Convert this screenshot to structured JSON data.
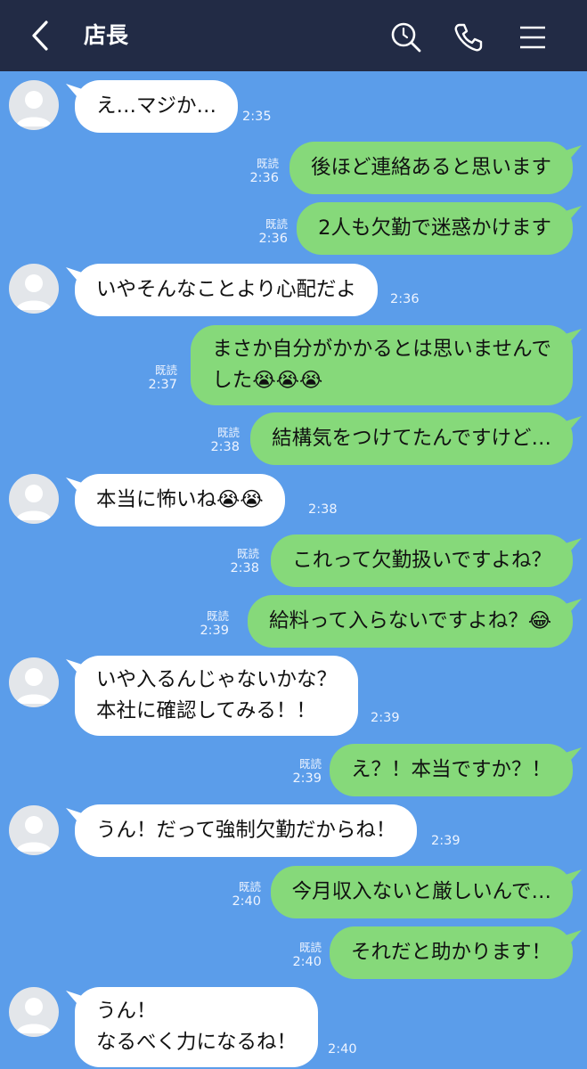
{
  "header": {
    "title": "店長",
    "bg_color": "#222b45"
  },
  "colors": {
    "background": "#5b9dea",
    "incoming_bubble": "#ffffff",
    "outgoing_bubble": "#86d97a"
  },
  "messages": [
    {
      "dir": "in",
      "text": "え…マジか…",
      "time": "2:35"
    },
    {
      "dir": "out",
      "text": "後ほど連絡あると思います",
      "read": "既読",
      "time": "2:36"
    },
    {
      "dir": "out",
      "text": "2人も欠勤で迷惑かけます",
      "read": "既読",
      "time": "2:36"
    },
    {
      "dir": "in",
      "text": "いやそんなことより心配だよ",
      "time": "2:36"
    },
    {
      "dir": "out",
      "text": "まさか自分がかかるとは思いませんで",
      "text2": "した😭😭😭",
      "read": "既読",
      "time": "2:37"
    },
    {
      "dir": "out",
      "text": "結構気をつけてたんですけど…",
      "read": "既読",
      "time": "2:38"
    },
    {
      "dir": "in",
      "text": "本当に怖いね😭😭",
      "time": "2:38"
    },
    {
      "dir": "out",
      "text": "これって欠勤扱いですよね？",
      "read": "既読",
      "time": "2:38"
    },
    {
      "dir": "out",
      "text": "給料って入らないですよね？😂",
      "read": "既読",
      "time": "2:39"
    },
    {
      "dir": "in",
      "text": "いや入るんじゃないかな？",
      "text2": "本社に確認してみる！！",
      "time": "2:39"
    },
    {
      "dir": "out",
      "text": "え？！本当ですか？！",
      "read": "既読",
      "time": "2:39"
    },
    {
      "dir": "in",
      "text": "うん！だって強制欠勤だからね！",
      "time": "2:39"
    },
    {
      "dir": "out",
      "text": "今月収入ないと厳しいんで…",
      "read": "既読",
      "time": "2:40"
    },
    {
      "dir": "out",
      "text": "それだと助かります！",
      "read": "既読",
      "time": "2:40"
    },
    {
      "dir": "in",
      "text": "うん！",
      "text2": "なるべく力になるね！",
      "time": "2:40"
    }
  ]
}
